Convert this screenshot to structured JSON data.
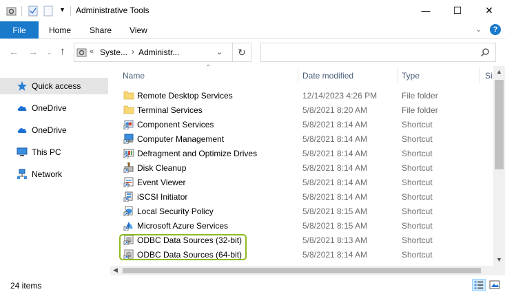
{
  "window": {
    "title": "Administrative Tools",
    "minimize_glyph": "—",
    "maximize_glyph": "☐",
    "close_glyph": "✕"
  },
  "ribbon": {
    "tabs": [
      {
        "label": "File"
      },
      {
        "label": "Home"
      },
      {
        "label": "Share"
      },
      {
        "label": "View"
      }
    ],
    "help_label": "?"
  },
  "address": {
    "overflow": "«",
    "crumbs": [
      "Syste...",
      "Administr..."
    ],
    "separator": "›",
    "refresh_glyph": "↻",
    "search_placeholder": "",
    "search_glyph": "⚲"
  },
  "nav": {
    "items": [
      {
        "label": "Quick access",
        "icon": "star-icon",
        "selected": true
      },
      {
        "label": "OneDrive",
        "icon": "cloud-icon"
      },
      {
        "label": "OneDrive",
        "icon": "cloud-icon"
      },
      {
        "label": "This PC",
        "icon": "monitor-icon"
      },
      {
        "label": "Network",
        "icon": "network-icon"
      }
    ]
  },
  "columns": {
    "name": "Name",
    "date": "Date modified",
    "type": "Type",
    "size": "Siz"
  },
  "files": [
    {
      "name": "Remote Desktop Services",
      "date": "12/14/2023 4:26 PM",
      "type": "File folder",
      "icon": "folder-icon"
    },
    {
      "name": "Terminal Services",
      "date": "5/8/2021 8:20 AM",
      "type": "File folder",
      "icon": "folder-icon"
    },
    {
      "name": "Component Services",
      "date": "5/8/2021 8:14 AM",
      "type": "Shortcut",
      "icon": "component-services-icon"
    },
    {
      "name": "Computer Management",
      "date": "5/8/2021 8:14 AM",
      "type": "Shortcut",
      "icon": "computer-management-icon"
    },
    {
      "name": "Defragment and Optimize Drives",
      "date": "5/8/2021 8:14 AM",
      "type": "Shortcut",
      "icon": "defrag-icon"
    },
    {
      "name": "Disk Cleanup",
      "date": "5/8/2021 8:14 AM",
      "type": "Shortcut",
      "icon": "disk-cleanup-icon"
    },
    {
      "name": "Event Viewer",
      "date": "5/8/2021 8:14 AM",
      "type": "Shortcut",
      "icon": "event-viewer-icon"
    },
    {
      "name": "iSCSI Initiator",
      "date": "5/8/2021 8:14 AM",
      "type": "Shortcut",
      "icon": "iscsi-icon"
    },
    {
      "name": "Local Security Policy",
      "date": "5/8/2021 8:15 AM",
      "type": "Shortcut",
      "icon": "security-policy-icon"
    },
    {
      "name": "Microsoft Azure Services",
      "date": "5/8/2021 8:15 AM",
      "type": "Shortcut",
      "icon": "azure-icon"
    },
    {
      "name": "ODBC Data Sources (32-bit)",
      "date": "5/8/2021 8:13 AM",
      "type": "Shortcut",
      "icon": "odbc-icon"
    },
    {
      "name": "ODBC Data Sources (64-bit)",
      "date": "5/8/2021 8:14 AM",
      "type": "Shortcut",
      "icon": "odbc-icon"
    }
  ],
  "status": {
    "count": "24 items"
  },
  "colors": {
    "accent": "#1979ca",
    "highlight": "#8dba1e",
    "folder": "#f8d775",
    "selected_nav": "#e5e5e5"
  }
}
